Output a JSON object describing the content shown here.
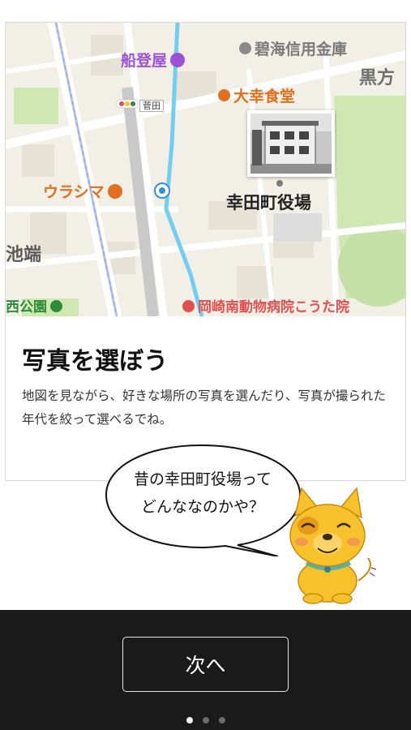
{
  "map": {
    "place_labels": [
      {
        "id": "funatoya",
        "text": "船登屋",
        "color": "#9b52d6",
        "icon": "hotel-icon"
      },
      {
        "id": "hekikai",
        "text": "碧海信用金庫",
        "color": "#7a7a7a",
        "icon": "bank-icon"
      },
      {
        "id": "kurokata",
        "text": "黒方",
        "color": "#6f6f6f"
      },
      {
        "id": "daikou",
        "text": "大幸食堂",
        "color": "#e07020",
        "icon": "restaurant-icon"
      },
      {
        "id": "kanda",
        "text": "菅田",
        "color": "#444444"
      },
      {
        "id": "urashima",
        "text": "ウラシマ",
        "color": "#e07020",
        "icon": "shop-icon"
      },
      {
        "id": "ikebata",
        "text": "池端",
        "color": "#5a5a5a"
      },
      {
        "id": "nishikoen",
        "text": "西公園",
        "color": "#2e8b3a",
        "icon": "park-icon"
      },
      {
        "id": "hospital",
        "text": "岡崎南動物病院こうた院",
        "color": "#e0504f",
        "icon": "hospital-icon"
      },
      {
        "id": "townhall",
        "text": "幸田町役場",
        "color": "#222222"
      }
    ],
    "photo_pin": {
      "alt": "幸田町役場の写真",
      "icon": "photo-pin-icon"
    }
  },
  "card": {
    "title": "写真を選ぼう",
    "description": "地図を見ながら、好きな場所の写真を選んだり、写真が撮られた年代を絞って選べるでね。"
  },
  "speech": {
    "line1": "昔の幸田町役場って",
    "line2": "どんななのかや？"
  },
  "mascot": {
    "name": "mascot-dog-icon"
  },
  "footer": {
    "next_label": "次へ",
    "pagination": {
      "current": 1,
      "total": 3
    }
  },
  "colors": {
    "map_bg": "#f2efe6",
    "road": "#ffffff",
    "park": "#cfe8b2",
    "water": "#73cdf0",
    "footer_bg": "#1a1a1a",
    "poi_orange": "#e07020",
    "poi_purple": "#9b52d6",
    "poi_green": "#2e8b3a",
    "poi_red": "#e0504f",
    "mascot_yellow": "#f7c12b"
  }
}
